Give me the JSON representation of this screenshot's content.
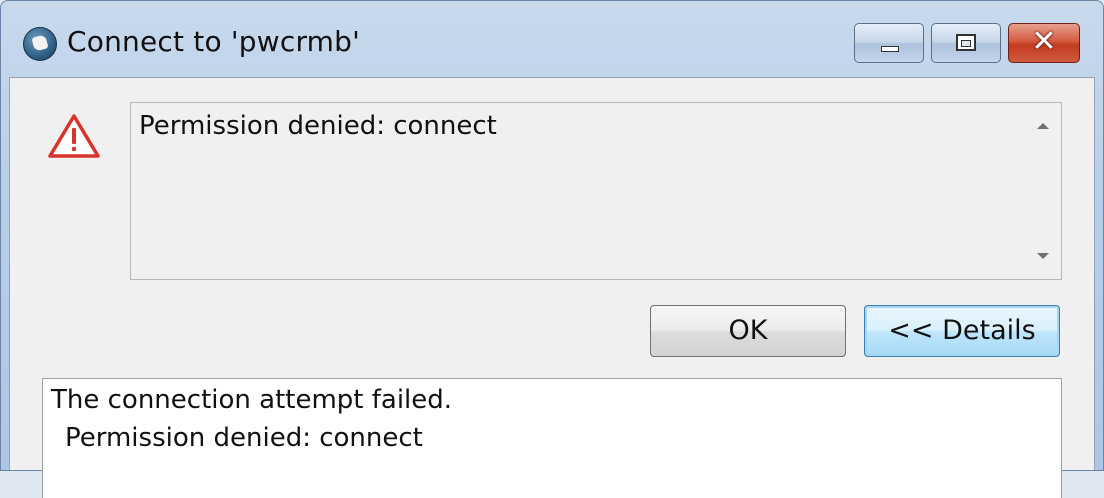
{
  "window": {
    "title": "Connect to 'pwcrmb'",
    "icon": "app-icon",
    "controls": {
      "minimize_icon": "minimize-icon",
      "maximize_icon": "maximize-icon",
      "close_glyph": "✕"
    }
  },
  "dialog": {
    "icon": "warning-icon",
    "message": "Permission denied: connect",
    "buttons": {
      "ok_label": "OK",
      "details_label": "<< Details"
    },
    "details": {
      "line1": "The connection attempt failed.",
      "line2": "Permission denied: connect"
    }
  },
  "colors": {
    "warning": "#d9342b",
    "close_button": "#c23b20",
    "details_border": "#3c7fb1"
  }
}
